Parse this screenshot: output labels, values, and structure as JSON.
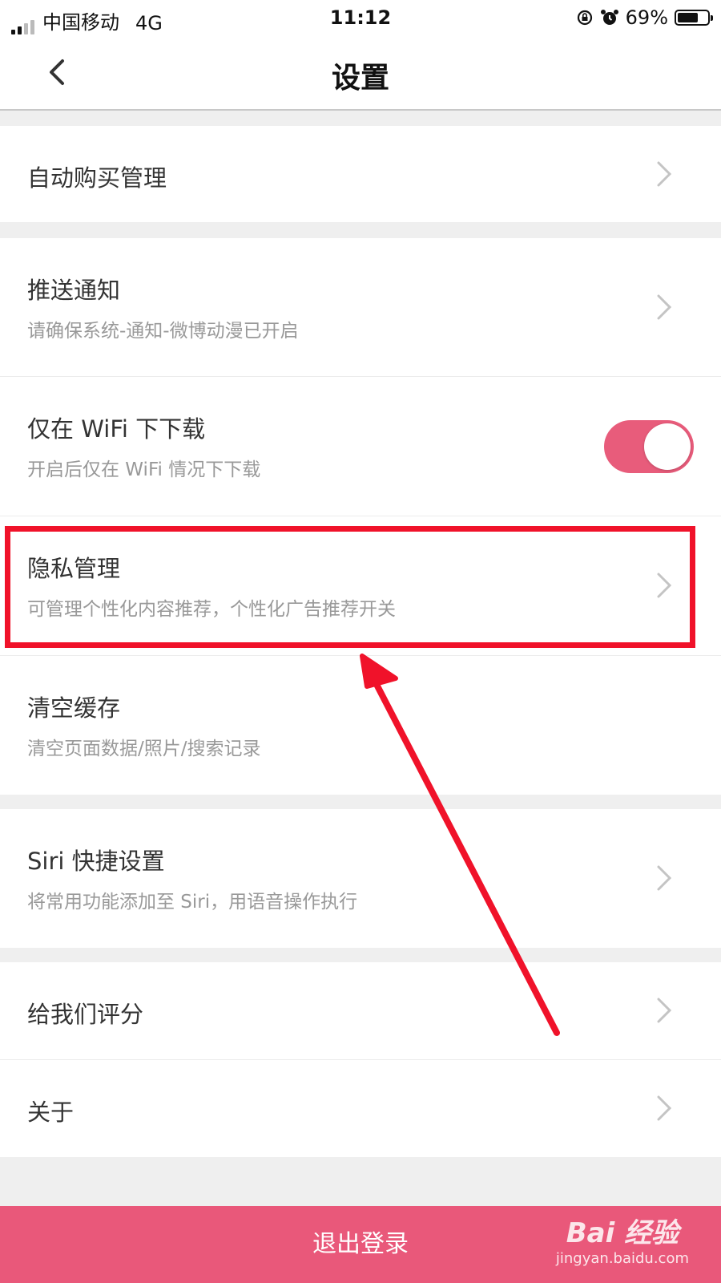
{
  "status_bar": {
    "carrier": "中国移动",
    "network": "4G",
    "time": "11:12",
    "battery_percent": "69%",
    "battery_level": 0.69
  },
  "nav": {
    "title": "设置"
  },
  "settings": {
    "auto_purchase": {
      "label": "自动购买管理"
    },
    "push": {
      "label": "推送通知",
      "sub": "请确保系统-通知-微博动漫已开启"
    },
    "wifi": {
      "label": "仅在 WiFi 下下载",
      "sub": "开启后仅在 WiFi 情况下下载",
      "enabled": true
    },
    "privacy": {
      "label": "隐私管理",
      "sub": "可管理个性化内容推荐，个性化广告推荐开关"
    },
    "cache": {
      "label": "清空缓存",
      "sub": "清空页面数据/照片/搜索记录"
    },
    "siri": {
      "label": "Siri 快捷设置",
      "sub": "将常用功能添加至 Siri，用语音操作执行"
    },
    "rate": {
      "label": "给我们评分"
    },
    "about": {
      "label": "关于"
    }
  },
  "logout_label": "退出登录",
  "watermark": {
    "logo": "Bai 经验",
    "url": "jingyan.baidu.com"
  },
  "colors": {
    "accent": "#e9587a",
    "toggle": "#e85c7b",
    "annotation": "#f0122a"
  },
  "icons": [
    "back-chevron-icon",
    "chevron-right-icon",
    "alarm-icon",
    "rotation-lock-icon"
  ]
}
